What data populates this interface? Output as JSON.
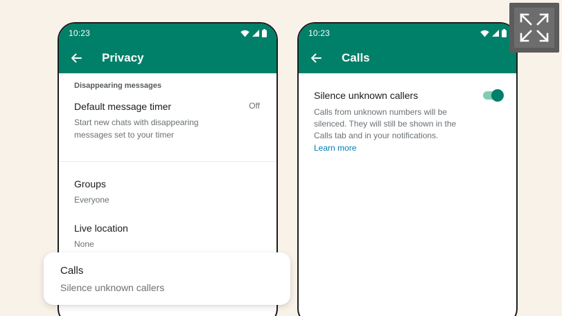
{
  "left_phone": {
    "status_time": "10:23",
    "title": "Privacy",
    "section_header": "Disappearing messages",
    "timer": {
      "title": "Default message timer",
      "value": "Off",
      "description": "Start new chats with disappearing messages set to your timer"
    },
    "groups": {
      "title": "Groups",
      "value": "Everyone"
    },
    "location": {
      "title": "Live location",
      "value": "None"
    }
  },
  "calls_card": {
    "title": "Calls",
    "subtitle": "Silence unknown callers"
  },
  "right_phone": {
    "status_time": "10:23",
    "title": "Calls",
    "setting": {
      "title": "Silence unknown callers",
      "description": "Calls from unknown numbers will be silenced. They will still be shown in the Calls tab and in your notifications.",
      "link": "Learn more",
      "enabled": true
    }
  },
  "icons": {
    "back": "back-arrow-icon",
    "wifi": "wifi-icon",
    "signal": "signal-icon",
    "battery": "battery-icon",
    "expand": "expand-icon"
  },
  "colors": {
    "appbar": "#008069",
    "background": "#f9f2e9",
    "link": "#027eb5",
    "toggle_thumb": "#008069",
    "toggle_track": "#7fcdb5"
  }
}
